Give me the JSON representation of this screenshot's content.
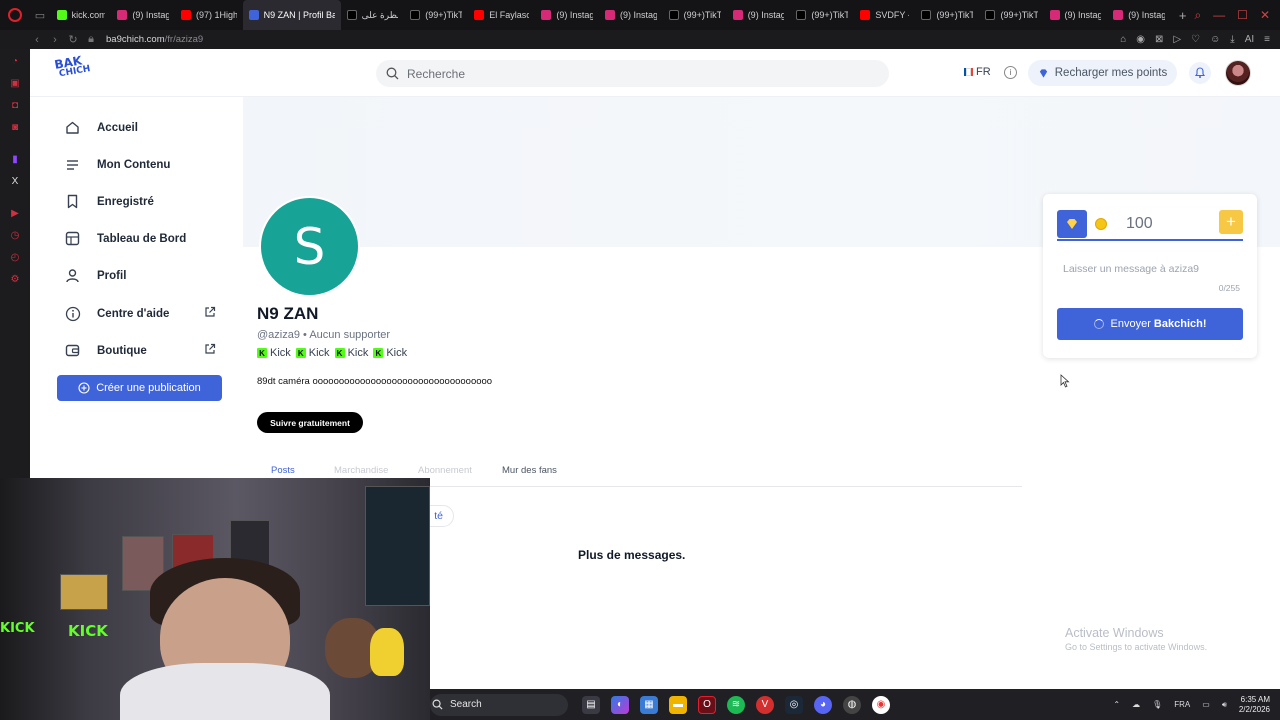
{
  "browser": {
    "tabs": [
      {
        "label": "",
        "color": "#53fc18"
      },
      {
        "label": "kick.com",
        "color": "#53fc18"
      },
      {
        "label": "(9) Instag",
        "color": "#d62976"
      },
      {
        "label": "(97) 1High",
        "color": "#ff0000"
      },
      {
        "label": "N9 ZAN | Profil Ba",
        "color": "#3f63d8",
        "active": true
      },
      {
        "label": "نظرة على",
        "color": "#000000"
      },
      {
        "label": "(99+)TikT",
        "color": "#000000"
      },
      {
        "label": "El Faylasc",
        "color": "#ff0000"
      },
      {
        "label": "(9) Instag",
        "color": "#d62976"
      },
      {
        "label": "(9) Instag",
        "color": "#d62976"
      },
      {
        "label": "(99+)TikT",
        "color": "#000000"
      },
      {
        "label": "(9) Instag",
        "color": "#d62976"
      },
      {
        "label": "(99+)TikT",
        "color": "#000000"
      },
      {
        "label": "SVDFY - ",
        "color": "#ff0000"
      },
      {
        "label": "(99+)TikT",
        "color": "#000000"
      },
      {
        "label": "(99+)TikT",
        "color": "#000000"
      },
      {
        "label": "(9) Instag",
        "color": "#d62976"
      },
      {
        "label": "(9) Instag",
        "color": "#d62976"
      }
    ],
    "new_tab": "+",
    "address": {
      "domain": "ba9chich.com",
      "path": "/fr/aziza9"
    }
  },
  "header": {
    "logo_line1": "BAK",
    "logo_line2": "CHICH",
    "search_placeholder": "Recherche",
    "lang": "FR",
    "recharge_label": "Recharger mes points"
  },
  "nav": {
    "items": [
      {
        "label": "Accueil",
        "icon": "home-icon"
      },
      {
        "label": "Mon Contenu",
        "icon": "list-icon"
      },
      {
        "label": "Enregistré",
        "icon": "bookmark-icon"
      },
      {
        "label": "Tableau de Bord",
        "icon": "dashboard-icon"
      },
      {
        "label": "Profil",
        "icon": "user-icon"
      },
      {
        "label": "Centre d'aide",
        "icon": "info-icon",
        "external": true
      },
      {
        "label": "Boutique",
        "icon": "wallet-icon",
        "external": true
      }
    ],
    "create_label": "Créer une publication"
  },
  "profile": {
    "initial": "S",
    "name": "N9 ZAN",
    "handle": "@aziza9 • Aucun supporter",
    "kick_label": "Kick",
    "bio": "89dt caméra oooooooooooooooooooooooooooooooooo",
    "follow_label": "Suivre gratuitement",
    "tabs": [
      "Posts",
      "Marchandise",
      "Abonnement",
      "Mur des fans"
    ],
    "filter_chip": "té",
    "empty_text": "Plus de messages."
  },
  "tip": {
    "amount": "100",
    "message_placeholder": "Laisser un message à aziza9",
    "counter": "0/255",
    "send_prefix": "Envoyer ",
    "send_bold": "Bakchich!"
  },
  "activation": {
    "title": "Activate Windows",
    "subtitle": "Go to Settings to activate Windows."
  },
  "taskbar": {
    "search_placeholder": "Search",
    "lang": "FRA",
    "time": "6:35 AM",
    "date": "2/2/2026"
  }
}
